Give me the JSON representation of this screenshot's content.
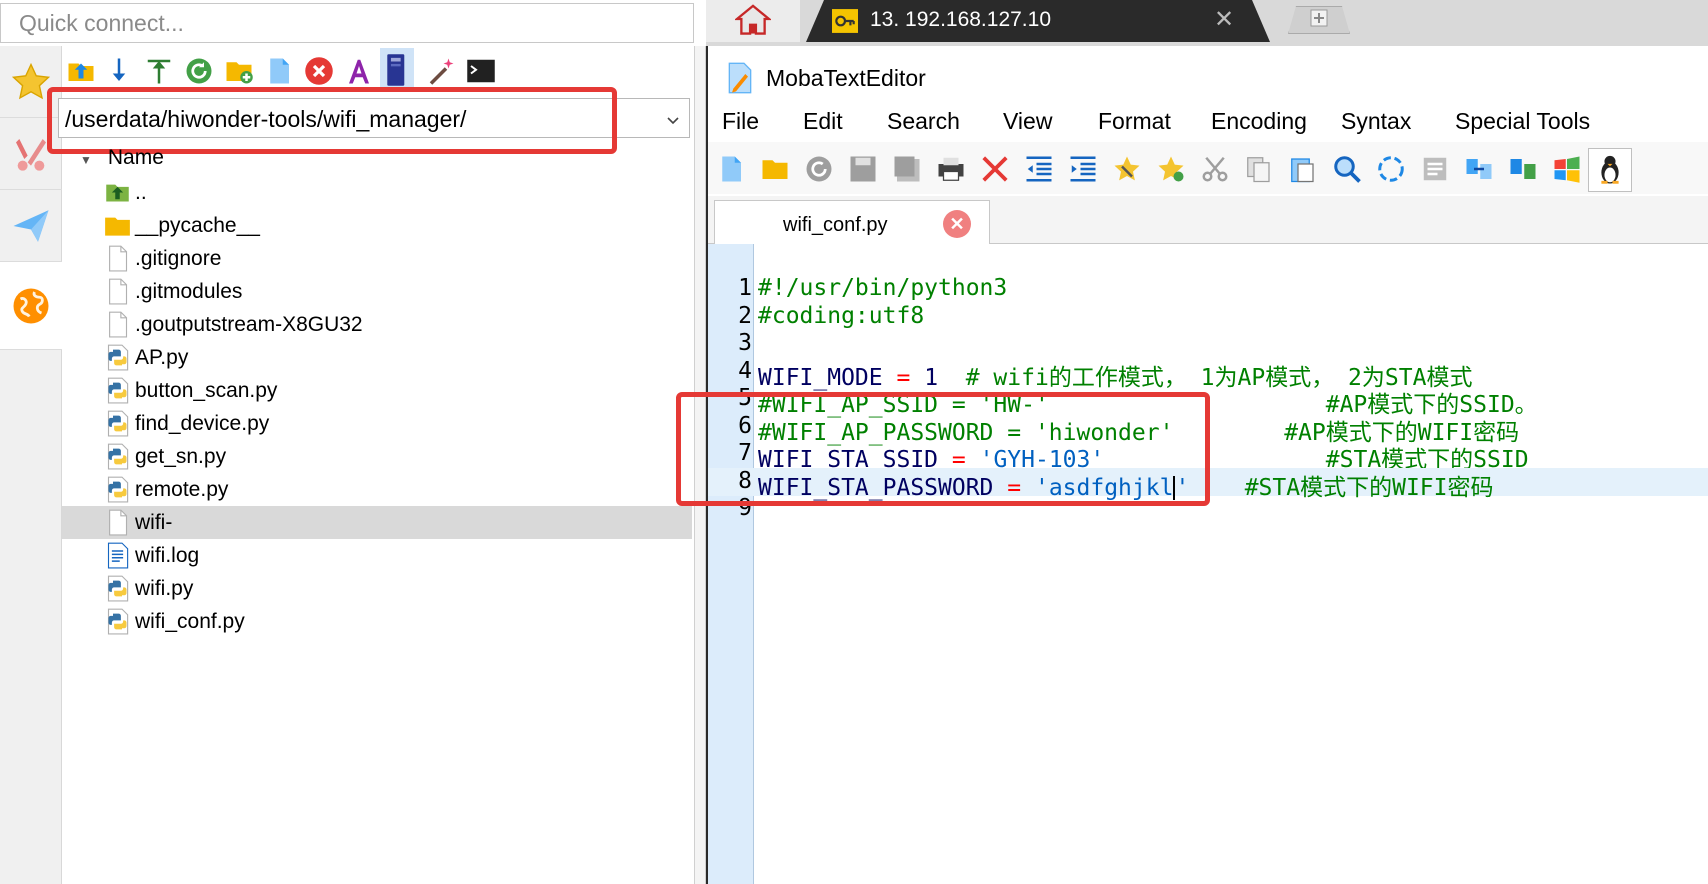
{
  "quick_connect": {
    "placeholder": "Quick connect..."
  },
  "file_browser": {
    "path": "/userdata/hiwonder-tools/wifi_manager/",
    "column_header": "Name",
    "files": [
      {
        "name": "..",
        "icon": "parent-folder-icon"
      },
      {
        "name": "__pycache__",
        "icon": "folder-icon"
      },
      {
        "name": ".gitignore",
        "icon": "file-icon"
      },
      {
        "name": ".gitmodules",
        "icon": "file-icon"
      },
      {
        "name": ".goutputstream-X8GU32",
        "icon": "file-icon"
      },
      {
        "name": "AP.py",
        "icon": "python-file-icon"
      },
      {
        "name": "button_scan.py",
        "icon": "python-file-icon"
      },
      {
        "name": "find_device.py",
        "icon": "python-file-icon"
      },
      {
        "name": "get_sn.py",
        "icon": "python-file-icon"
      },
      {
        "name": "remote.py",
        "icon": "python-file-icon"
      },
      {
        "name": "wifi-",
        "icon": "file-icon"
      },
      {
        "name": "wifi.log",
        "icon": "text-file-icon"
      },
      {
        "name": "wifi.py",
        "icon": "python-file-icon"
      },
      {
        "name": "wifi_conf.py",
        "icon": "python-file-icon"
      }
    ]
  },
  "tabs": {
    "session_title": "13. 192.168.127.10",
    "close_glyph": "✕"
  },
  "editor": {
    "app_name": "MobaTextEditor",
    "menu": [
      "File",
      "Edit",
      "Search",
      "View",
      "Format",
      "Encoding",
      "Syntax",
      "Special Tools"
    ],
    "file_tab": "wifi_conf.py",
    "close_glyph": "✕",
    "lines": [
      {
        "n": "1",
        "parts": [
          [
            "comment",
            "#!/usr/bin/python3"
          ]
        ]
      },
      {
        "n": "2",
        "parts": [
          [
            "comment",
            "#coding:utf8"
          ]
        ]
      },
      {
        "n": "3",
        "parts": []
      },
      {
        "n": "4",
        "parts": [
          [
            "plain",
            "WIFI_MODE "
          ],
          [
            "op",
            "="
          ],
          [
            "plain",
            " 1  "
          ],
          [
            "comment",
            "# wifi的工作模式， 1为AP模式， 2为STA模式"
          ]
        ]
      },
      {
        "n": "5",
        "parts": [
          [
            "comment",
            "#WIFI_AP_SSID = 'HW-'                    #AP模式下的SSID。"
          ]
        ]
      },
      {
        "n": "6",
        "parts": [
          [
            "comment",
            "#WIFI_AP_PASSWORD = 'hiwonder'        #AP模式下的WIFI密码"
          ]
        ]
      },
      {
        "n": "7",
        "parts": [
          [
            "plain",
            "WIFI_STA_SSID "
          ],
          [
            "op",
            "="
          ],
          [
            "plain",
            " "
          ],
          [
            "str",
            "'GYH-103'"
          ],
          [
            "plain",
            "                "
          ],
          [
            "comment",
            "#STA模式下的SSID"
          ]
        ]
      },
      {
        "n": "8",
        "parts": [
          [
            "plain",
            "WIFI_STA_PASSWORD "
          ],
          [
            "op",
            "="
          ],
          [
            "plain",
            " "
          ],
          [
            "str",
            "'asdfghjkl"
          ],
          [
            "cursor",
            ""
          ],
          [
            "str",
            "'"
          ],
          [
            "plain",
            "    "
          ],
          [
            "comment",
            "#STA模式下的WIFI密码"
          ]
        ]
      },
      {
        "n": "9",
        "parts": []
      }
    ],
    "current_line": 8
  },
  "colors": {
    "highlight_red": "#e53935",
    "comment_green": "#008000",
    "operator_red": "#ff0000",
    "string_blue": "#0060c0",
    "gutter_blue": "#dcecfb"
  }
}
